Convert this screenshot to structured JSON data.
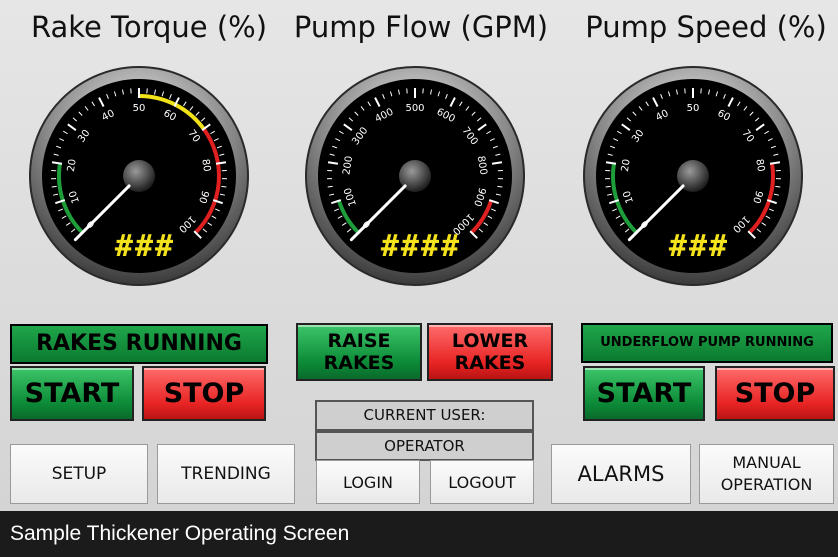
{
  "gauges": [
    {
      "title": "Rake Torque (%)",
      "readout": "###",
      "ticks": [
        "0",
        "10",
        "20",
        "30",
        "40",
        "50",
        "60",
        "70",
        "80",
        "90",
        "100"
      ],
      "max": 100,
      "value": 0,
      "bands": [
        {
          "from": 0,
          "to": 20,
          "color": "#1e9e3a"
        },
        {
          "from": 50,
          "to": 70,
          "color": "#f2e21a"
        },
        {
          "from": 70,
          "to": 100,
          "color": "#e02020"
        }
      ]
    },
    {
      "title": "Pump Flow (GPM)",
      "readout": "####",
      "ticks": [
        "0",
        "100",
        "200",
        "300",
        "400",
        "500",
        "600",
        "700",
        "800",
        "900",
        "1000"
      ],
      "max": 1000,
      "value": 0,
      "bands": [
        {
          "from": 0,
          "to": 100,
          "color": "#1e9e3a"
        },
        {
          "from": 900,
          "to": 1000,
          "color": "#e02020"
        }
      ]
    },
    {
      "title": "Pump Speed (%)",
      "readout": "###",
      "ticks": [
        "0",
        "10",
        "20",
        "30",
        "40",
        "50",
        "60",
        "70",
        "80",
        "90",
        "100"
      ],
      "max": 100,
      "value": 0,
      "bands": [
        {
          "from": 0,
          "to": 20,
          "color": "#1e9e3a"
        },
        {
          "from": 80,
          "to": 100,
          "color": "#e02020"
        }
      ]
    }
  ],
  "rakes": {
    "status": "RAKES RUNNING",
    "start": "START",
    "stop": "STOP",
    "raise_line1": "RAISE",
    "raise_line2": "RAKES",
    "lower_line1": "LOWER",
    "lower_line2": "RAKES"
  },
  "pump": {
    "status": "UNDERFLOW PUMP RUNNING",
    "start": "START",
    "stop": "STOP"
  },
  "user": {
    "label": "CURRENT USER:",
    "name": "OPERATOR",
    "login": "LOGIN",
    "logout": "LOGOUT"
  },
  "nav": {
    "setup": "SETUP",
    "trending": "TRENDING",
    "alarms": "ALARMS",
    "manual_line1": "MANUAL",
    "manual_line2": "OPERATION"
  },
  "footer": {
    "caption": "Sample Thickener Operating Screen"
  },
  "colors": {
    "status_green": "#0f8a35",
    "button_red": "#e82424",
    "gauge_face": "#000000",
    "readout": "#f4e21c"
  }
}
